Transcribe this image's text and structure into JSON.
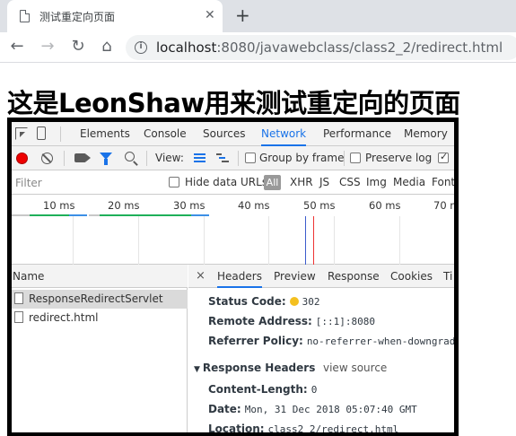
{
  "browser": {
    "tab_title": "测试重定向页面",
    "tab_close": "✕",
    "new_tab": "+",
    "url_host": "localhost",
    "url_rest": ":8080/javawebclass/class2_2/redirect.html"
  },
  "page": {
    "heading": "这是LeonShaw用来测试重定向的页面"
  },
  "devtools": {
    "tabs": [
      "Elements",
      "Console",
      "Sources",
      "Network",
      "Performance",
      "Memory"
    ],
    "active_tab": "Network",
    "toolbar": {
      "view_label": "View:",
      "group_by_frame": "Group by frame",
      "preserve_log": "Preserve log"
    },
    "filter": {
      "placeholder": "Filter",
      "hide_data_urls": "Hide data URLs",
      "all": "All",
      "types": [
        "XHR",
        "JS",
        "CSS",
        "Img",
        "Media",
        "Font"
      ]
    },
    "overview": {
      "ticks": [
        "10 ms",
        "20 ms",
        "30 ms",
        "40 ms",
        "50 ms",
        "60 ms",
        "70 m"
      ]
    },
    "requests": {
      "header": "Name",
      "items": [
        {
          "name": "ResponseRedirectServlet",
          "selected": true
        },
        {
          "name": "redirect.html",
          "selected": false
        }
      ]
    },
    "details": {
      "close": "×",
      "tabs": [
        "Headers",
        "Preview",
        "Response",
        "Cookies",
        "Ti"
      ],
      "active_tab": "Headers",
      "general": {
        "status_code_label": "Status Code:",
        "status_code": "302",
        "remote_address_label": "Remote Address:",
        "remote_address": "[::1]:8080",
        "referrer_policy_label": "Referrer Policy:",
        "referrer_policy": "no-referrer-when-downgrade"
      },
      "response_headers": {
        "title": "Response Headers",
        "view_source": "view source",
        "content_length_label": "Content-Length:",
        "content_length": "0",
        "date_label": "Date:",
        "date": "Mon, 31 Dec 2018 05:07:40 GMT",
        "location_label": "Location:",
        "location": "class2_2/redirect.html"
      }
    }
  },
  "colors": {
    "accent": "#1a73e8",
    "record": "#ee0000",
    "status_dot": "#f4c020"
  }
}
